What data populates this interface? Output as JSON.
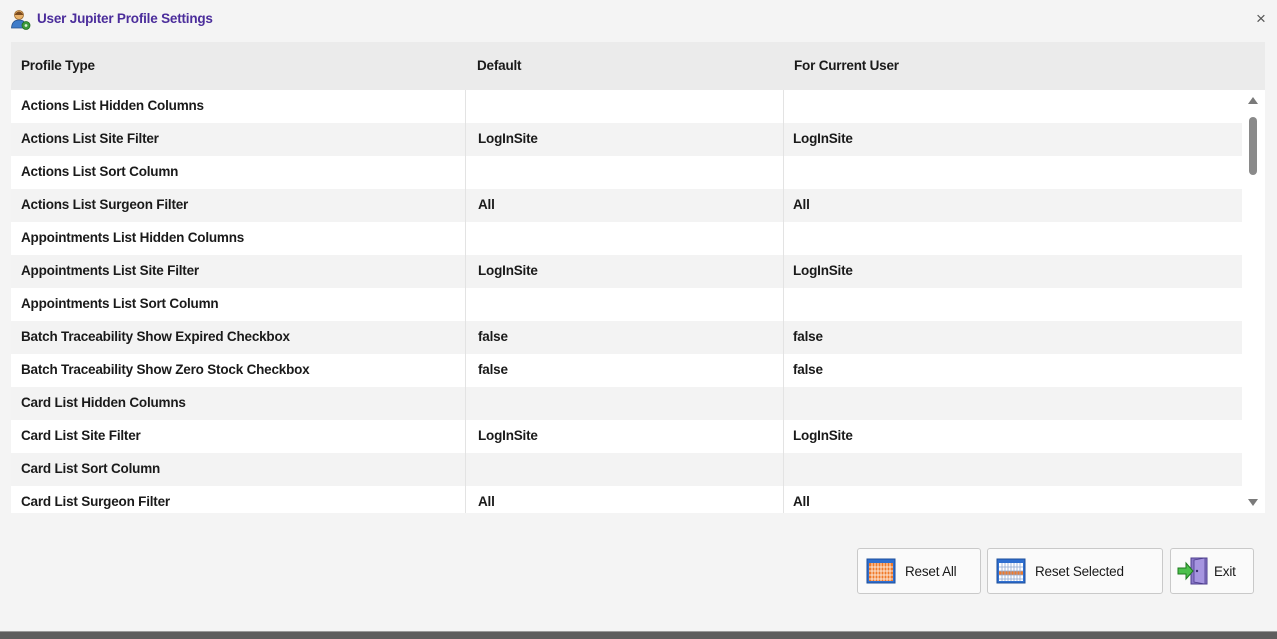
{
  "window": {
    "title": "User Jupiter Profile Settings",
    "title_color": "#4b2d9b",
    "close_symbol": "×"
  },
  "grid": {
    "columns": [
      "Profile Type",
      "Default",
      "For Current User"
    ],
    "rows": [
      [
        "Actions List Hidden Columns",
        "",
        ""
      ],
      [
        "Actions List Site Filter",
        "LogInSite",
        "LogInSite"
      ],
      [
        "Actions List Sort Column",
        "",
        ""
      ],
      [
        "Actions List Surgeon Filter",
        "All",
        "All"
      ],
      [
        "Appointments List Hidden Columns",
        "",
        ""
      ],
      [
        "Appointments List Site Filter",
        "LogInSite",
        "LogInSite"
      ],
      [
        "Appointments List Sort Column",
        "",
        ""
      ],
      [
        "Batch Traceability Show Expired Checkbox",
        "false",
        "false"
      ],
      [
        "Batch Traceability Show Zero Stock Checkbox",
        "false",
        "false"
      ],
      [
        "Card List Hidden Columns",
        "",
        ""
      ],
      [
        "Card List Site Filter",
        "LogInSite",
        "LogInSite"
      ],
      [
        "Card List Sort Column",
        "",
        ""
      ],
      [
        "Card List Surgeon Filter",
        "All",
        "All"
      ]
    ]
  },
  "buttons": {
    "reset_all": "Reset All",
    "reset_selected": "Reset Selected",
    "exit": "Exit"
  },
  "icons": {
    "title": "user-settings-icon",
    "close": "close-icon",
    "reset_all": "calendar-grid-icon",
    "reset_selected": "calendar-grid-icon",
    "exit": "exit-door-icon",
    "scroll_up": "scroll-up-arrow-icon",
    "scroll_down": "scroll-down-arrow-icon"
  }
}
